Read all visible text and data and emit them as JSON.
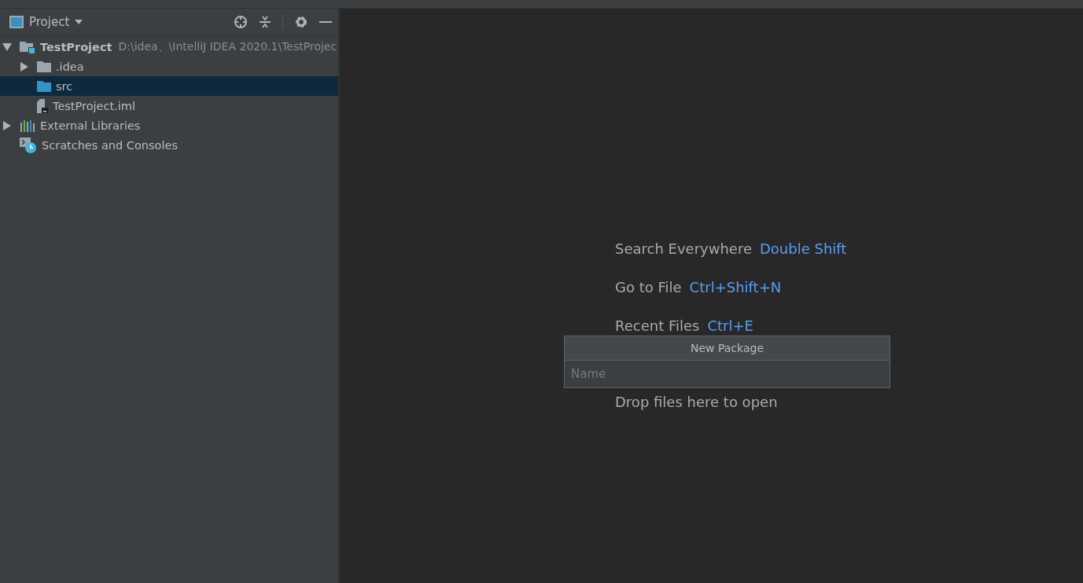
{
  "project_panel": {
    "title": "Project"
  },
  "tree": [
    {
      "label": "TestProject",
      "kind": "module",
      "path": "D:\\idea、\\IntelliJ IDEA 2020.1\\TestProjec",
      "expanded": true,
      "selected": false,
      "children": [
        {
          "label": ".idea",
          "kind": "folder",
          "expanded": false,
          "selected": false
        },
        {
          "label": "src",
          "kind": "source-folder",
          "selected": true
        },
        {
          "label": "TestProject.iml",
          "kind": "file",
          "selected": false
        }
      ]
    },
    {
      "label": "External Libraries",
      "kind": "libraries",
      "expanded": false,
      "selected": false
    },
    {
      "label": "Scratches and Consoles",
      "kind": "scratches",
      "selected": false
    }
  ],
  "hints": [
    {
      "label": "Search Everywhere",
      "shortcut": "Double Shift"
    },
    {
      "label": "Go to File",
      "shortcut": "Ctrl+Shift+N"
    },
    {
      "label": "Recent Files",
      "shortcut": "Ctrl+E"
    },
    {
      "label": "Drop files here to open"
    }
  ],
  "popup": {
    "title": "New Package",
    "placeholder": "Name"
  }
}
